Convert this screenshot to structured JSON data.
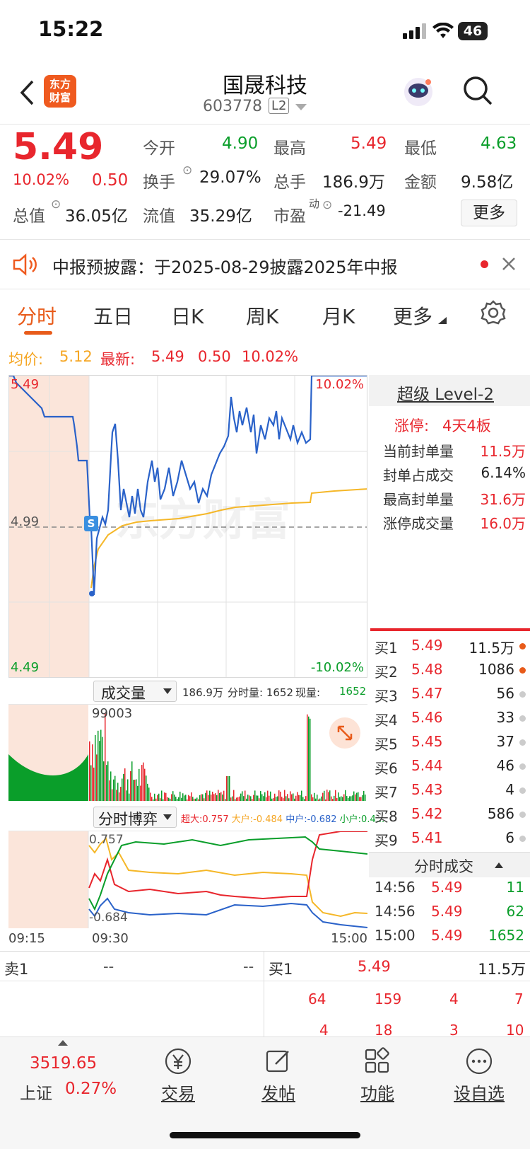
{
  "status": {
    "time": "15:22",
    "battery": "46"
  },
  "header": {
    "title": "国晟科技",
    "code": "603778",
    "level_badge": "L2",
    "logo_text": "东方\n财富"
  },
  "quote": {
    "price": "5.49",
    "change_pct": "10.02%",
    "change": "0.50",
    "open_label": "今开",
    "open": "4.90",
    "high_label": "最高",
    "high": "5.49",
    "low_label": "最低",
    "low": "4.63",
    "turnover_label": "换手",
    "turnover": "29.07%",
    "volume_label": "总手",
    "volume": "186.9万",
    "amount_label": "金额",
    "amount": "9.58亿",
    "mktcap_label": "总值",
    "mktcap": "36.05亿",
    "float_label": "流值",
    "float": "35.29亿",
    "pe_label": "市盈",
    "pe_sup": "动",
    "pe": "-21.49",
    "more": "更多"
  },
  "notice": {
    "text": "中报预披露：于2025-08-29披露2025年中报"
  },
  "tabs": [
    "分时",
    "五日",
    "日K",
    "周K",
    "月K",
    "更多"
  ],
  "legend": {
    "avg_label": "均价:",
    "avg": "5.12",
    "latest_label": "最新:",
    "latest": "5.49",
    "change": "0.50",
    "pct": "10.02%"
  },
  "chart_labels": {
    "top_price": "5.49",
    "mid_price": "4.99",
    "bottom_price": "4.49",
    "top_pct": "10.02%",
    "bottom_pct": "-10.02%",
    "s_marker": "S",
    "watermark": "东方财富"
  },
  "volume": {
    "title": "成交量",
    "info1": "186.9万",
    "info2": "分时量: 1652",
    "info3": "现量:",
    "info3_val": "1652",
    "max_label": "99003"
  },
  "game": {
    "title": "分时博弈",
    "super_label": "超大:",
    "super": "0.757",
    "large_label": "大户:",
    "large": "-0.484",
    "mid_label": "中户:",
    "mid": "-0.682",
    "small_label": "小户:",
    "small": "0.4...",
    "top_val": "0.757",
    "bottom_val": "-0.684"
  },
  "time_axis": [
    "09:15",
    "09:30",
    "15:00"
  ],
  "level2": {
    "title": "超级 Level-2",
    "limit_label": "涨停:",
    "limit_val": "4天4板",
    "rows": [
      {
        "label": "当前封单量",
        "value": "11.5万"
      },
      {
        "label": "封单占成交",
        "value": "6.14%"
      },
      {
        "label": "最高封单量",
        "value": "31.6万"
      },
      {
        "label": "涨停成交量",
        "value": "16.0万"
      }
    ]
  },
  "buys": [
    {
      "label": "买1",
      "price": "5.49",
      "vol": "11.5万"
    },
    {
      "label": "买2",
      "price": "5.48",
      "vol": "1086"
    },
    {
      "label": "买3",
      "price": "5.47",
      "vol": "56"
    },
    {
      "label": "买4",
      "price": "5.46",
      "vol": "33"
    },
    {
      "label": "买5",
      "price": "5.45",
      "vol": "37"
    },
    {
      "label": "买6",
      "price": "5.44",
      "vol": "46"
    },
    {
      "label": "买7",
      "price": "5.43",
      "vol": "4"
    },
    {
      "label": "买8",
      "price": "5.42",
      "vol": "586"
    },
    {
      "label": "买9",
      "price": "5.41",
      "vol": "6"
    }
  ],
  "ticks": {
    "title": "分时成交",
    "rows": [
      {
        "time": "14:56",
        "price": "5.49",
        "vol": "11"
      },
      {
        "time": "14:56",
        "price": "5.49",
        "vol": "62"
      },
      {
        "time": "15:00",
        "price": "5.49",
        "vol": "1652"
      }
    ]
  },
  "book_bottom": {
    "sell1_label": "卖1",
    "sell1_price": "--",
    "sell1_vol": "--",
    "buy1_label": "买1",
    "buy1_price": "5.49",
    "buy1_vol": "11.5万",
    "row2": [
      "64",
      "159",
      "4",
      "7"
    ],
    "row3": [
      "4",
      "18",
      "3",
      "10"
    ]
  },
  "bottom_nav": {
    "index_value": "3519.65",
    "index_name": "上证",
    "index_pct": "0.27%",
    "items": [
      "交易",
      "发帖",
      "功能",
      "设自选"
    ]
  },
  "colors": {
    "up": "#e8262d",
    "down": "#0a9e2a",
    "accent": "#e85b1a",
    "avg_line": "#f5b728",
    "price_line": "#2a62c9"
  }
}
